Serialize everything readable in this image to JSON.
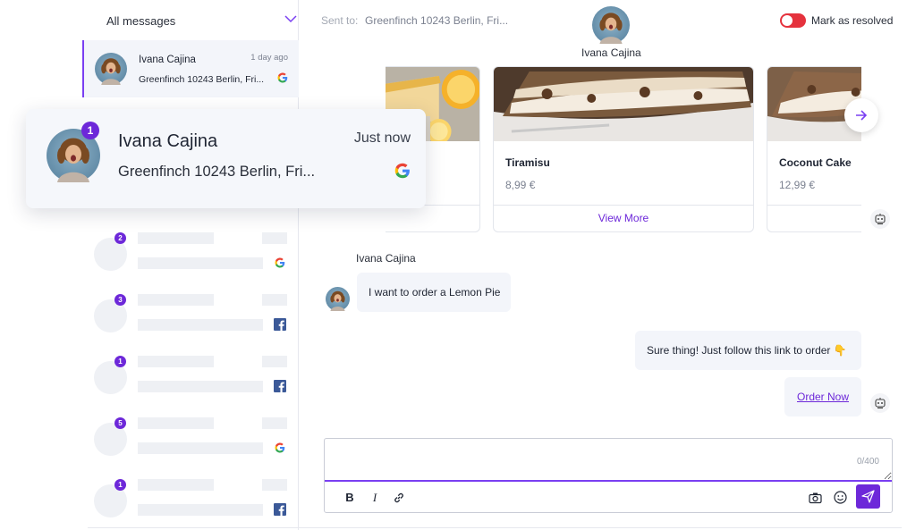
{
  "sidebar": {
    "filter_label": "All messages",
    "active_conversation": {
      "name": "Ivana Cajina",
      "time": "1 day ago",
      "address": "Greenfinch 10243 Berlin, Fri...",
      "channel_icon": "google-icon"
    },
    "placeholder_rows": [
      {
        "badge": "2",
        "channel_icon": "google-icon"
      },
      {
        "badge": "3",
        "channel_icon": "facebook-icon"
      },
      {
        "badge": "1",
        "channel_icon": "facebook-icon"
      },
      {
        "badge": "5",
        "channel_icon": "google-icon"
      },
      {
        "badge": "1",
        "channel_icon": "facebook-icon"
      }
    ]
  },
  "notification": {
    "badge": "1",
    "name": "Ivana Cajina",
    "time": "Just now",
    "address": "Greenfinch 10243 Berlin, Fri...",
    "channel_icon": "google-icon"
  },
  "header": {
    "sent_to_label": "Sent to:",
    "sent_to_value": "Greenfinch 10243 Berlin, Fri...",
    "contact_name": "Ivana Cajina",
    "resolve_label": "Mark as resolved",
    "resolve_toggle_on": false
  },
  "carousel": {
    "cards": [
      {
        "title": "",
        "price": "",
        "action": "",
        "image": "lemon-pie-image"
      },
      {
        "title": "Tiramisu",
        "price": "8,99 €",
        "action": "View More",
        "image": "tiramisu-image"
      },
      {
        "title": "Coconut Cake",
        "price": "12,99 €",
        "action": "",
        "image": "coconut-cake-image"
      }
    ]
  },
  "messages": {
    "incoming_sender": "Ivana Cajina",
    "incoming_text": "I want to order a Lemon Pie",
    "outgoing_text": "Sure thing! Just follow this link to order 👇",
    "outgoing_link": "Order Now"
  },
  "composer": {
    "placeholder": "",
    "counter": "0/400",
    "bold_label": "B",
    "italic_label": "I"
  },
  "colors": {
    "accent": "#6d28d9",
    "toggle_off": "#e5323d",
    "bubble_bg": "#f3f5fa"
  }
}
